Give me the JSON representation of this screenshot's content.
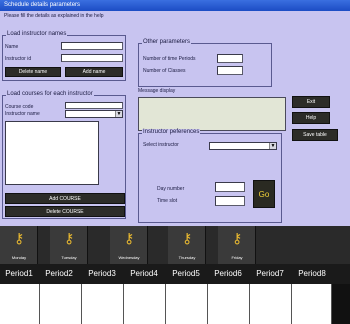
{
  "window": {
    "title": "Schedule details parameters"
  },
  "instruction": "Please fill the details as explained in the help",
  "instructor_names": {
    "legend": "Load instructor names",
    "name_label": "Name",
    "id_label": "Instructor id",
    "delete_label": "Delete name",
    "add_label": "Add name"
  },
  "courses": {
    "legend": "Load courses for each instructor",
    "code_label": "Course code",
    "instructor_label": "Instructor name",
    "add_label": "Add COURSE",
    "delete_label": "Delete COURSE"
  },
  "other_params": {
    "legend": "Other parameters",
    "periods_label": "Number of time Periods",
    "classes_label": "Number of Classes"
  },
  "message": {
    "label": "Message display"
  },
  "preferences": {
    "legend": "Instructor peferences",
    "select_label": "Select instructor",
    "day_label": "Day number",
    "time_label": "Time slot",
    "go_label": "Go"
  },
  "side_buttons": {
    "exit": "Exit",
    "help": "Help",
    "save": "Save table"
  },
  "tabs": [
    "Monday",
    "Tuesday",
    "Wednesday",
    "Thursday",
    "Friday"
  ],
  "periods": [
    "Period1",
    "Period2",
    "Period3",
    "Period4",
    "Period5",
    "Period6",
    "Period7",
    "Period8"
  ],
  "icons": {
    "tab_icon": "key-icon"
  }
}
